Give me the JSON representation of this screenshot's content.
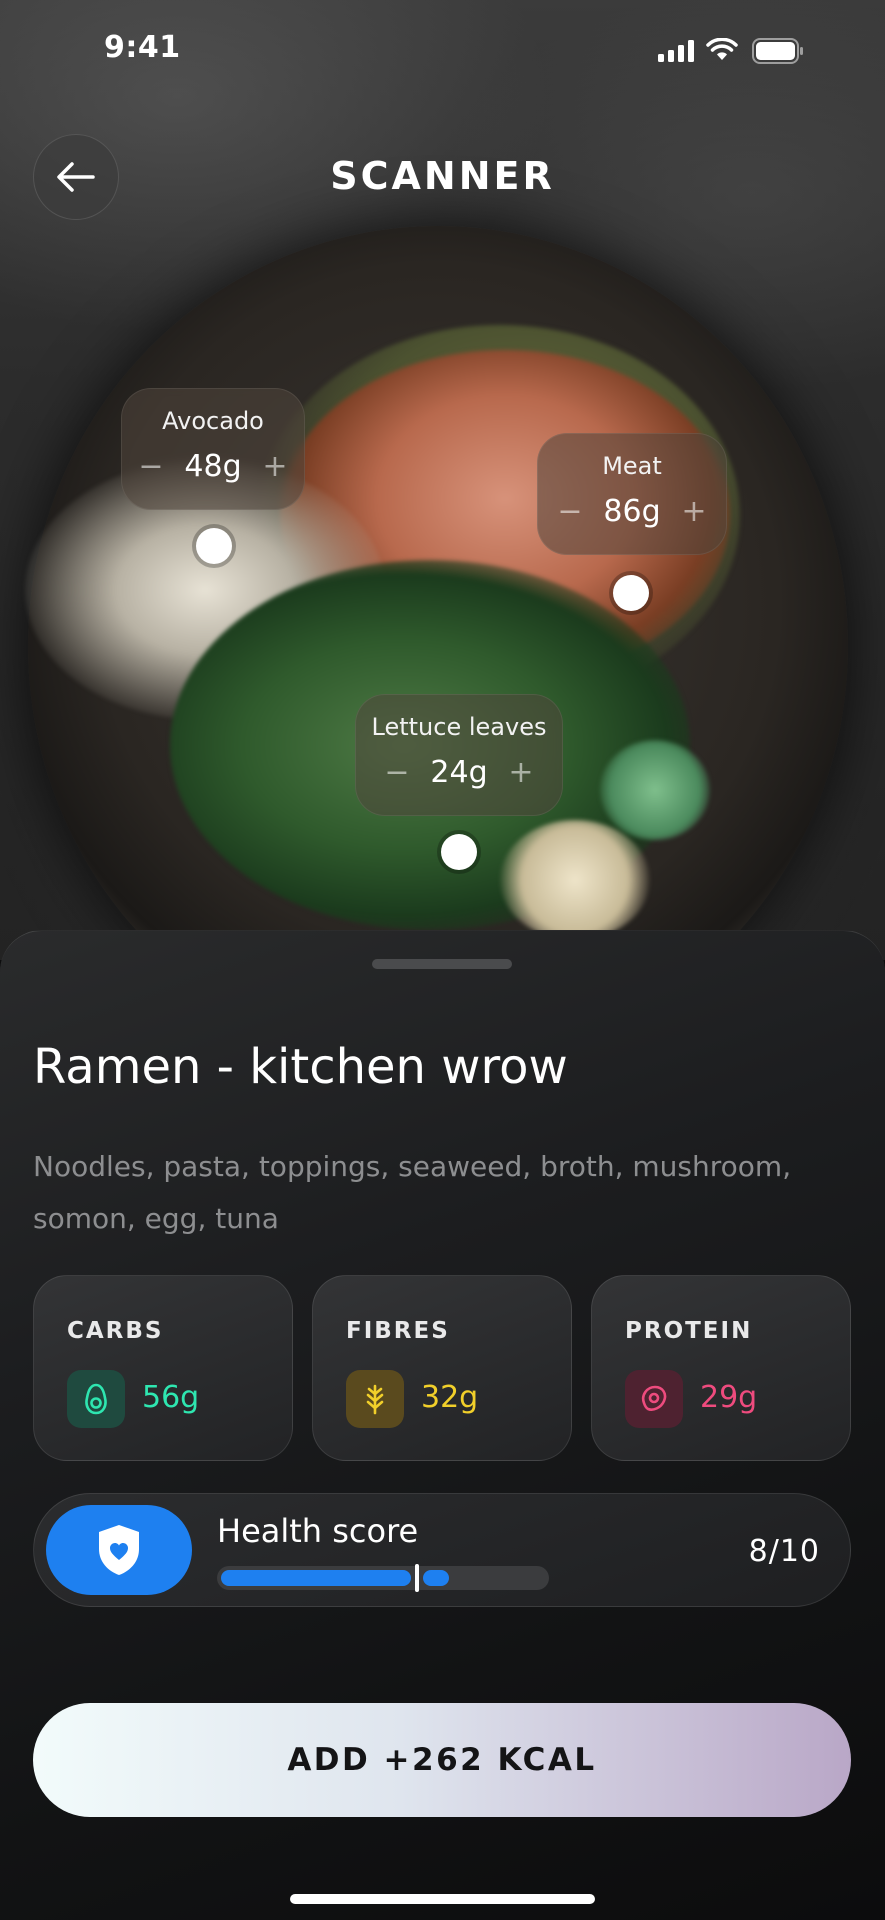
{
  "status_bar": {
    "time": "9:41",
    "signal_icon": "cellular-signal-icon",
    "wifi_icon": "wifi-icon",
    "battery_icon": "battery-icon"
  },
  "header": {
    "title": "SCANNER",
    "back_icon": "arrow-left-icon"
  },
  "ingredients": [
    {
      "name": "Avocado",
      "amount": "48g",
      "minus": "−",
      "plus": "+"
    },
    {
      "name": "Meat",
      "amount": "86g",
      "minus": "−",
      "plus": "+"
    },
    {
      "name": "Lettuce leaves",
      "amount": "24g",
      "minus": "−",
      "plus": "+"
    }
  ],
  "dish": {
    "title": "Ramen - kitchen wrow",
    "description": "Noodles, pasta, toppings, seaweed, broth, mushroom, somon, egg, tuna"
  },
  "macros": [
    {
      "label": "CARBS",
      "amount": "56g",
      "icon": "avocado-icon",
      "color": "#2ee6b0",
      "icon_bg": "#1f4a3f"
    },
    {
      "label": "FIBRES",
      "amount": "32g",
      "icon": "wheat-icon",
      "color": "#f1cf2a",
      "icon_bg": "#5a4a1e"
    },
    {
      "label": "PROTEIN",
      "amount": "29g",
      "icon": "meat-icon",
      "color": "#ee4b7e",
      "icon_bg": "#4e2230"
    }
  ],
  "health": {
    "label": "Health score",
    "score": "8/10",
    "value": 8,
    "max": 10,
    "icon": "shield-heart-icon",
    "accent": "#1e80f0"
  },
  "cta": {
    "label": "ADD +262 KCAL"
  }
}
